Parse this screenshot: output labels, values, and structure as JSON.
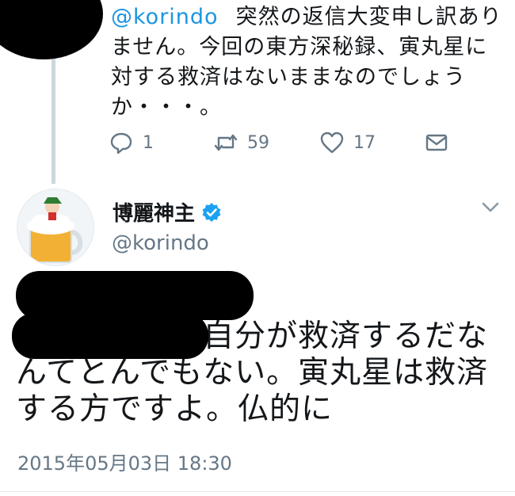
{
  "reply": {
    "mention": "@korindo",
    "text": "突然の返信大変申し訳ありません。今回の東方深秘録、寅丸星に対する救済はないままなのでしょうか・・・。",
    "reply_count": "1",
    "retweet_count": "59",
    "like_count": "17"
  },
  "main_tweet": {
    "display_name": "博麗神主",
    "handle": "@korindo",
    "text": "自分が救済するだなんてとんでもない。寅丸星は救済する方ですよ。仏的に",
    "timestamp": "2015年05月03日 18:30"
  },
  "colors": {
    "accent": "#1b95e0",
    "muted": "#657786",
    "verified": "#1da1f2",
    "redaction": "#000000"
  },
  "icons": {
    "reply": "reply-icon",
    "retweet": "retweet-icon",
    "like": "heart-icon",
    "dm": "envelope-icon",
    "verified": "verified-badge-icon",
    "more": "chevron-down-icon"
  }
}
